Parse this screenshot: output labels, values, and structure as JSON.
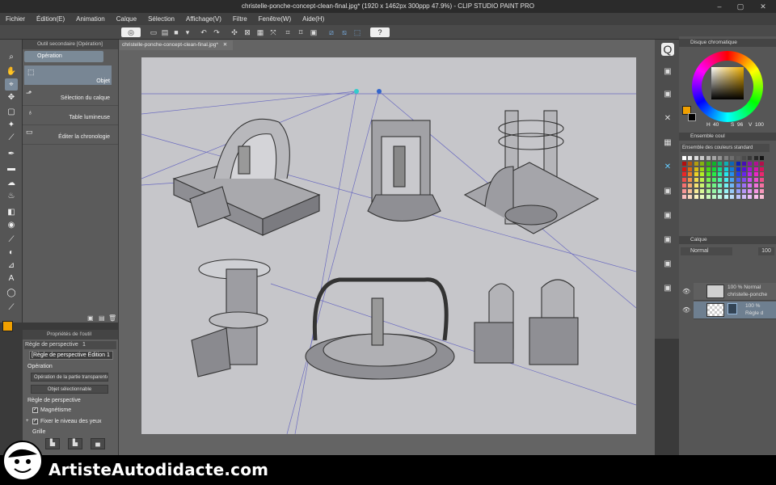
{
  "window": {
    "title": "christelle-ponche-concept-clean-final.jpg* (1920 x 1462px 300ppp 47.9%) - CLIP STUDIO PAINT PRO"
  },
  "menu": [
    "Fichier",
    "Édition(E)",
    "Animation",
    "Calque",
    "Sélection",
    "Affichage(V)",
    "Filtre",
    "Fenêtre(W)",
    "Aide(H)"
  ],
  "document": {
    "tab_label": "christelle-ponche-concept-clean-final.jpg*"
  },
  "subtool_panel": {
    "header": "Outil secondaire [Opération]",
    "group": "Opération",
    "items": [
      "Objet",
      "Sélection du calque",
      "Table lumineuse",
      "Éditer la chronologie"
    ]
  },
  "tool_properties": {
    "header": "Propriétés de l'outil",
    "ruler_name": "Règle de perspective",
    "ruler_index": "1",
    "ruler_edit": "[Règle de perspective Édition 1",
    "operation_label": "Opération",
    "operation_value": "Opération de la partie transparente",
    "selectable_value": "Objet sélectionnable",
    "perspective_label": "Règle de perspective",
    "magnetism_label": "Magnétisme",
    "eye_level_label": "Fixer le niveau des yeux",
    "grid_label": "Grille"
  },
  "color_panel": {
    "header": "Disque chromatique",
    "h_label": "H",
    "h_value": "40",
    "s_label": "S",
    "s_value": "96",
    "v_label": "V",
    "v_value": "100",
    "main_color": "#f0a000",
    "sub_color": "#000000"
  },
  "palette_panel": {
    "header": "Ensemble coul",
    "set_name": "Ensemble des couleurs standard"
  },
  "layer_panel": {
    "header": "Calque",
    "blend_mode": "Normal",
    "opacity": "100",
    "layers": [
      {
        "opacity": "100 % Normal",
        "name": "christelle-ponche"
      },
      {
        "opacity": "100 %",
        "name": "Règle d"
      }
    ]
  },
  "footer": {
    "brand": "ArtisteAutodidacte.com"
  }
}
